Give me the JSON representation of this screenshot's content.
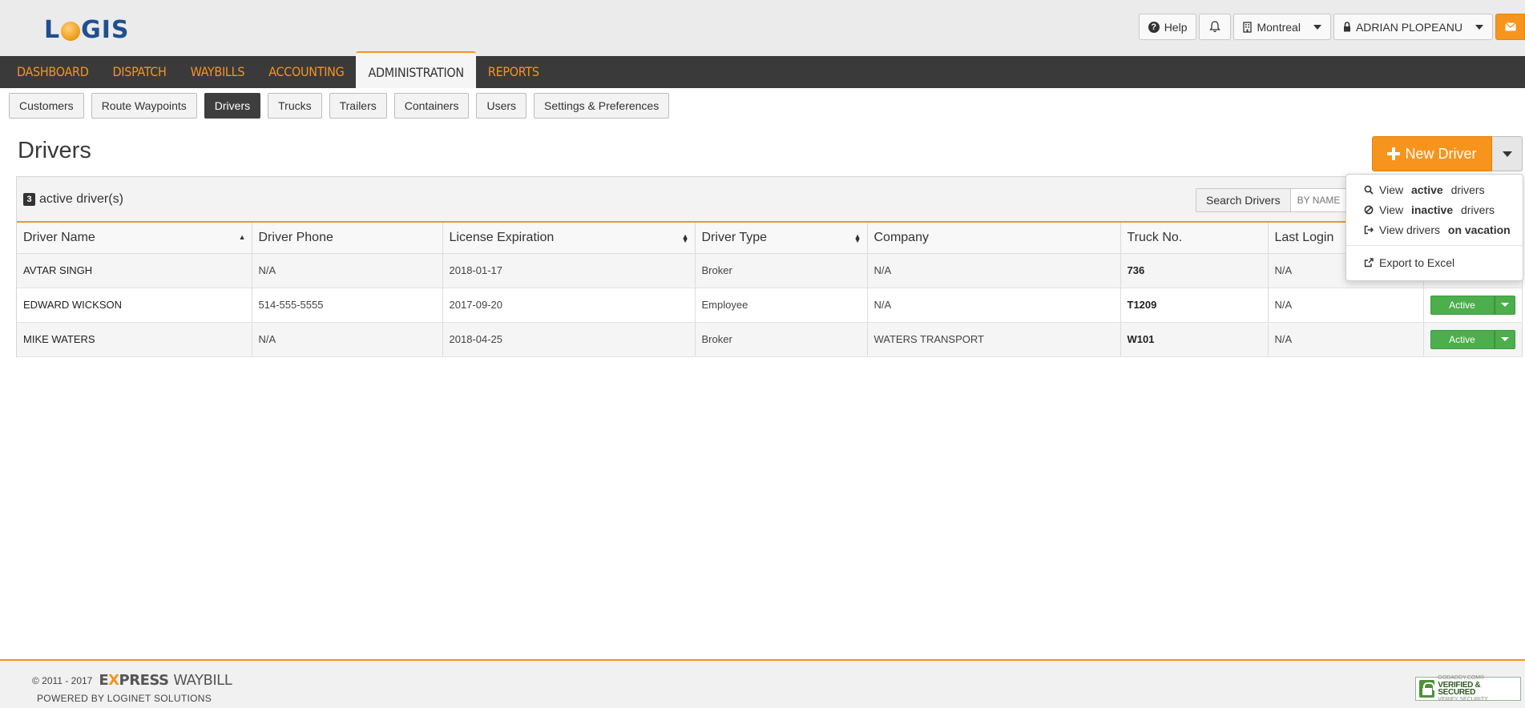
{
  "app": {
    "logo_text": "LOGIS"
  },
  "topbar": {
    "help_label": "Help",
    "location_label": "Montreal",
    "user_label": "ADRIAN PLOPEANU"
  },
  "main_nav": {
    "items": [
      {
        "label": "DASHBOARD"
      },
      {
        "label": "DISPATCH"
      },
      {
        "label": "WAYBILLS"
      },
      {
        "label": "ACCOUNTING"
      },
      {
        "label": "ADMINISTRATION",
        "active": true
      },
      {
        "label": "REPORTS"
      }
    ]
  },
  "sub_nav": {
    "items": [
      {
        "label": "Customers"
      },
      {
        "label": "Route Waypoints"
      },
      {
        "label": "Drivers",
        "active": true
      },
      {
        "label": "Trucks"
      },
      {
        "label": "Trailers"
      },
      {
        "label": "Containers"
      },
      {
        "label": "Users"
      },
      {
        "label": "Settings & Preferences"
      }
    ]
  },
  "page": {
    "title": "Drivers",
    "new_button_label": "New Driver"
  },
  "panel": {
    "count": "3",
    "count_label": "active driver(s)",
    "search_label": "Search Drivers",
    "search_placeholder": "BY NAME"
  },
  "table": {
    "columns": [
      "Driver Name",
      "Driver Phone",
      "License Expiration",
      "Driver Type",
      "Company",
      "Truck No.",
      "Last Login"
    ],
    "rows": [
      {
        "name": "AVTAR SINGH",
        "phone": "N/A",
        "license": "2018-01-17",
        "type": "Broker",
        "company": "N/A",
        "truck": "736",
        "last_login": "N/A",
        "status": ""
      },
      {
        "name": "EDWARD WICKSON",
        "phone": "514-555-5555",
        "license": "2017-09-20",
        "type": "Employee",
        "company": "N/A",
        "truck": "T1209",
        "last_login": "N/A",
        "status": "Active"
      },
      {
        "name": "MIKE WATERS",
        "phone": "N/A",
        "license": "2018-04-25",
        "type": "Broker",
        "company": "WATERS TRANSPORT",
        "truck": "W101",
        "last_login": "N/A",
        "status": "Active"
      }
    ]
  },
  "dropdown_menu": {
    "view_active_prefix": "View",
    "view_active_bold": "active",
    "view_active_suffix": "drivers",
    "view_inactive_prefix": "View",
    "view_inactive_bold": "inactive",
    "view_inactive_suffix": "drivers",
    "view_vacation_prefix": "View drivers",
    "view_vacation_bold": "on vacation",
    "export_label": "Export to Excel"
  },
  "footer": {
    "copyright": "© 2011 - 2017",
    "brand_e": "E",
    "brand_x": "X",
    "brand_press": "PRESS",
    "brand_waybill": "WAYBILL",
    "powered_by": "POWERED BY LOGINET SOLUTIONS",
    "seal_line1": "GODADDY.COM®",
    "seal_line2": "VERIFIED & SECURED",
    "seal_line3": "VERIFY SECURITY"
  },
  "colors": {
    "accent": "#f7941d",
    "nav_bg": "#3a3a3a",
    "logo_blue": "#1e4f8f",
    "active_green": "#4cae4c"
  }
}
